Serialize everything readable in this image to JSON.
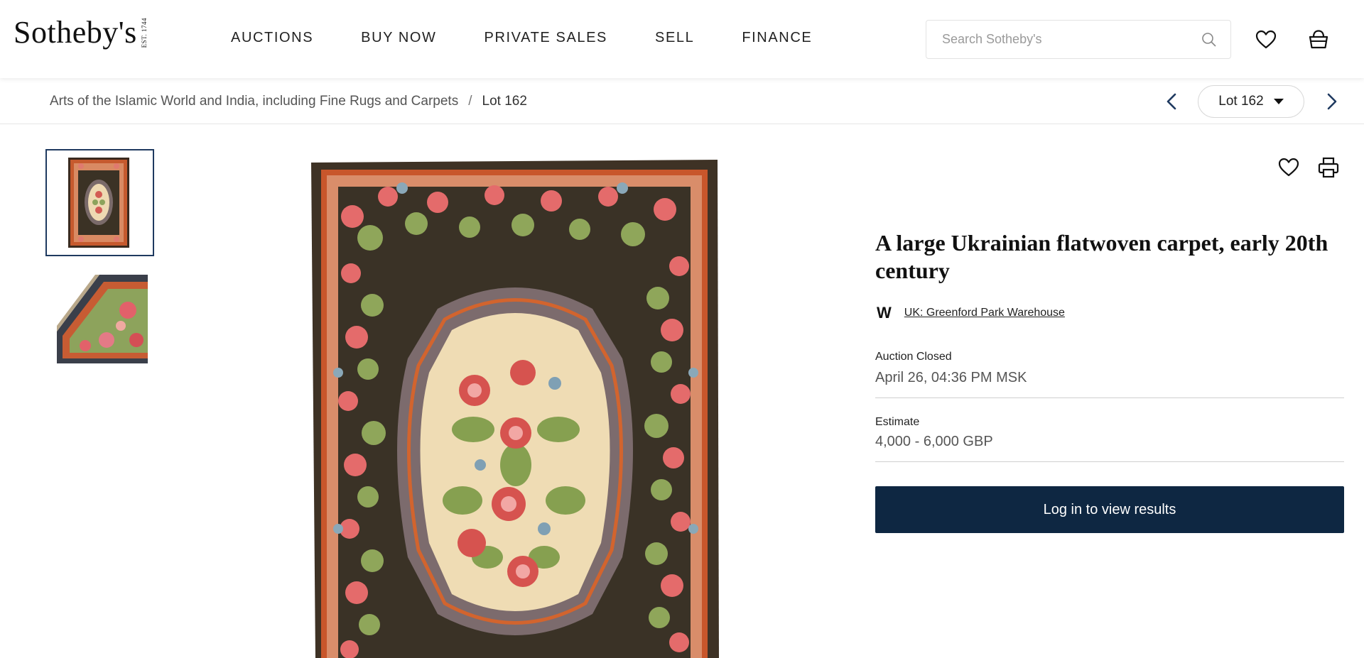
{
  "header": {
    "logo_text": "Sotheby's",
    "logo_est": "EST. 1744",
    "nav": [
      "AUCTIONS",
      "BUY NOW",
      "PRIVATE SALES",
      "SELL",
      "FINANCE"
    ],
    "search_placeholder": "Search Sotheby's",
    "icons": [
      "search-icon",
      "heart-icon",
      "basket-icon"
    ]
  },
  "breadcrumb": {
    "sale": "Arts of the Islamic World and India, including Fine Rugs and Carpets",
    "separator": "/",
    "current": "Lot 162"
  },
  "lot_nav": {
    "selected": "Lot 162",
    "icons": [
      "chevron-left-icon",
      "chevron-right-icon",
      "caret-down-icon"
    ]
  },
  "lot": {
    "title": "A large Ukrainian flatwoven carpet, early 20th century",
    "location_badge": "W",
    "location": "UK: Greenford Park Warehouse",
    "status_label": "Auction Closed",
    "status_value": "April 26, 04:36 PM MSK",
    "estimate_label": "Estimate",
    "estimate_value": "4,000 - 6,000 GBP",
    "cta": "Log in to view results"
  },
  "colors": {
    "accent_navy": "#0e2742",
    "thumb_border": "#1f3a60",
    "text_dark": "#111111",
    "text_muted": "#555555"
  }
}
